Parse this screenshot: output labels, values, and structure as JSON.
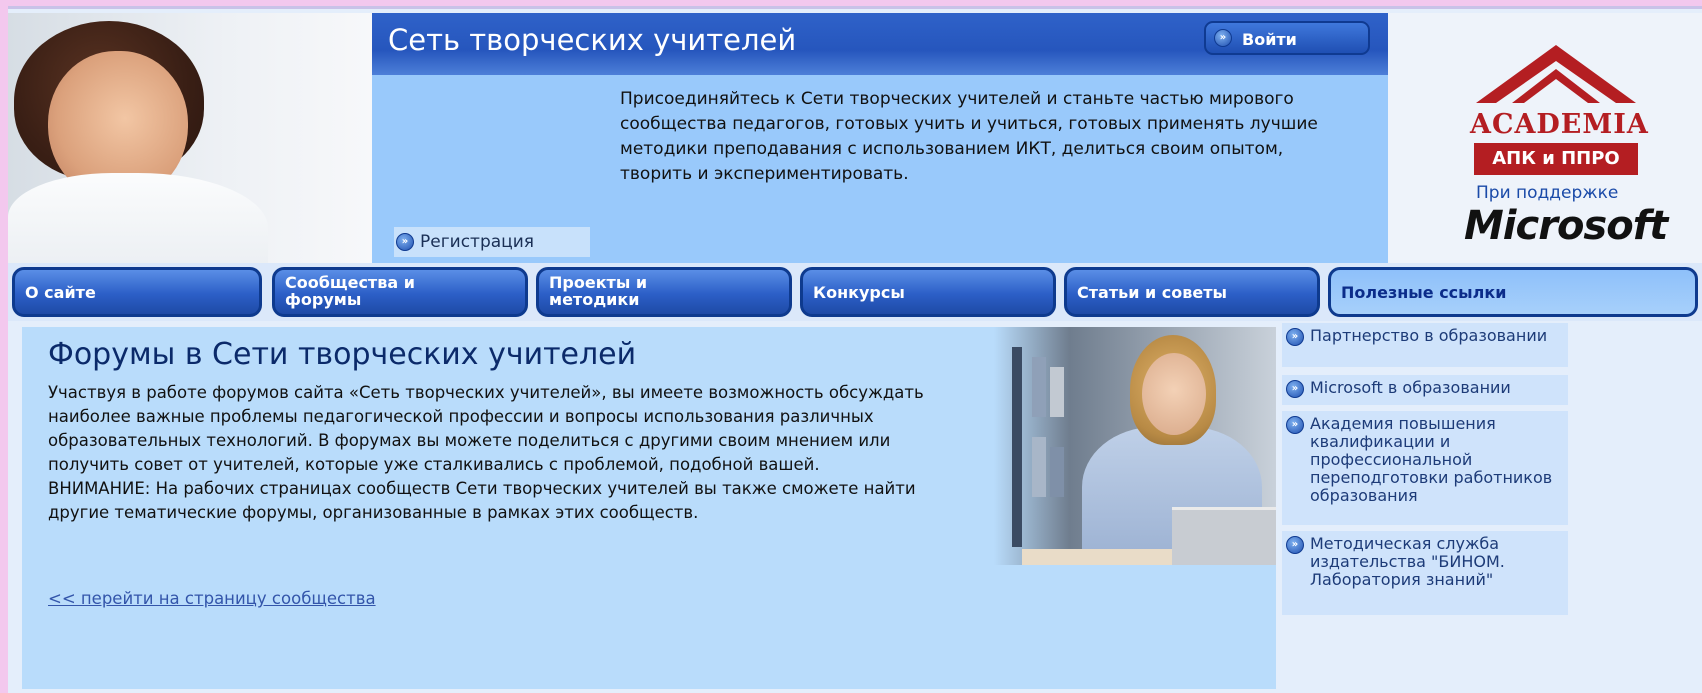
{
  "header": {
    "site_title": "Сеть творческих учителей",
    "login_label": "Войти",
    "intro_text": "Присоединяйтесь к Сети творческих учителей и станьте частью мирового сообщества педагогов, готовых учить и учиться, готовых применять лучшие методики преподавания с использованием ИКТ, делиться своим опытом, творить и экспериментировать.",
    "register_label": "Регистрация"
  },
  "branding": {
    "academia_word": "ACADEMIA",
    "apk_label": "АПК и ППРО",
    "support_label": "При поддержке",
    "microsoft_label": "Microsoft",
    "academia_color": "#b41e22"
  },
  "nav": {
    "tabs": [
      {
        "label": "О сайте"
      },
      {
        "label": "Сообщества и форумы"
      },
      {
        "label": "Проекты и методики"
      },
      {
        "label": "Конкурсы"
      },
      {
        "label": "Статьи и советы"
      },
      {
        "label": "Полезные ссылки",
        "active": true
      }
    ]
  },
  "main": {
    "title": "Форумы в Сети творческих учителей",
    "paragraph1": "Участвуя в работе форумов сайта «Сеть творческих учителей», вы имеете возможность обсуждать наиболее важные проблемы педагогической профессии и вопросы использования различных образовательных технологий. В форумах вы можете поделиться с другими своим мнением или получить совет от учителей, которые уже сталкивались с проблемой, подобной вашей.",
    "paragraph2": "ВНИМАНИЕ: На рабочих страницах сообществ Сети творческих учителей вы также сможете найти другие тематические форумы, организованные в рамках этих сообществ.",
    "community_link": "<< перейти на страницу сообщества"
  },
  "sidebar": {
    "items": [
      {
        "label": "Партнерство в образовании"
      },
      {
        "label": "Microsoft в образовании"
      },
      {
        "label": "Академия повышения квалификации и профессиональной переподготовки работников образования"
      },
      {
        "label": "Методическая служба издательства \"БИНОМ. Лаборатория знаний\""
      }
    ]
  },
  "colors": {
    "title_bar": "#2f62c9",
    "intro_panel": "#99c9fb",
    "main_panel": "#b9dcfb",
    "nav_tab": "#2c5fc7"
  }
}
